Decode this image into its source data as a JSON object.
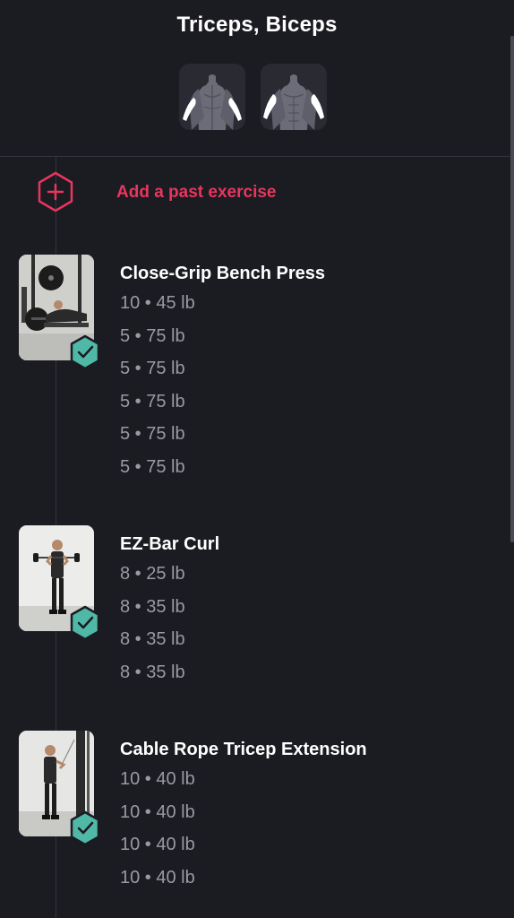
{
  "header": {
    "title": "Triceps, Biceps"
  },
  "add_past": {
    "label": "Add a past exercise"
  },
  "exercises": [
    {
      "name": "Close-Grip Bench Press",
      "sets": [
        "10 • 45 lb",
        "5 • 75 lb",
        "5 • 75 lb",
        "5 • 75 lb",
        "5 • 75 lb",
        "5 • 75 lb"
      ],
      "completed": true
    },
    {
      "name": "EZ-Bar Curl",
      "sets": [
        "8 • 25 lb",
        "8 • 35 lb",
        "8 • 35 lb",
        "8 • 35 lb"
      ],
      "completed": true
    },
    {
      "name": "Cable Rope Tricep Extension",
      "sets": [
        "10 • 40 lb",
        "10 • 40 lb",
        "10 • 40 lb",
        "10 • 40 lb"
      ],
      "completed": true
    }
  ],
  "colors": {
    "background": "#1b1b22",
    "accent": "#e8365d",
    "check": "#4fb8a6",
    "muted_text": "#9a9aa3"
  }
}
